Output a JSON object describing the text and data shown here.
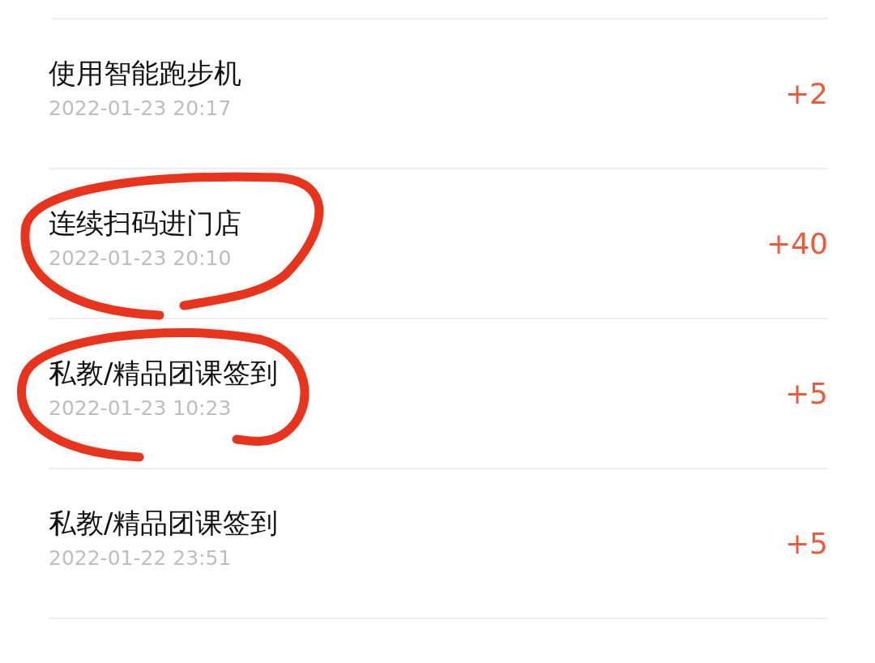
{
  "records": [
    {
      "title": "使用智能跑步机",
      "time": "2022-01-23 20:17",
      "points": "+2",
      "circled": false
    },
    {
      "title": "连续扫码进门店",
      "time": "2022-01-23 20:10",
      "points": "+40",
      "circled": true
    },
    {
      "title": "私教/精品团课签到",
      "time": "2022-01-23 10:23",
      "points": "+5",
      "circled": true
    },
    {
      "title": "私教/精品团课签到",
      "time": "2022-01-22 23:51",
      "points": "+5",
      "circled": false
    }
  ]
}
